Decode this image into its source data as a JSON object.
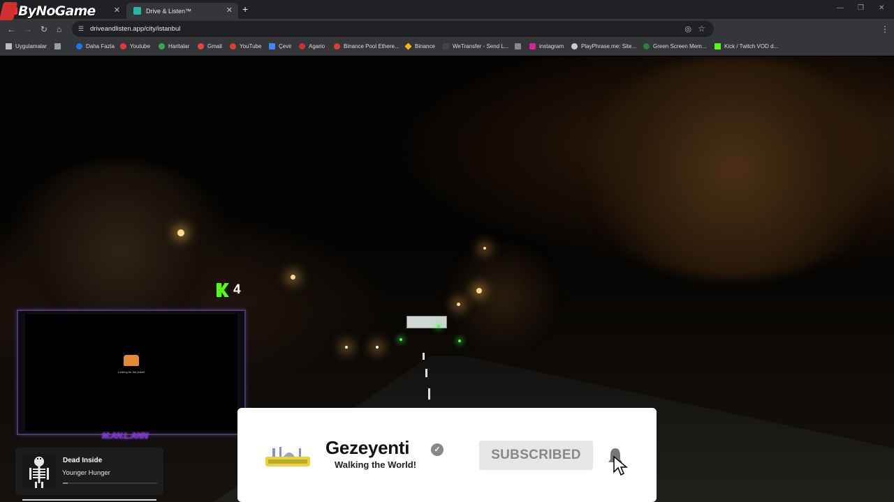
{
  "watermark": {
    "brand": "ByNoGame"
  },
  "browser": {
    "tabs": [
      {
        "label": "",
        "active": false,
        "color": "#e33"
      },
      {
        "label": "Drive & Listen™",
        "active": true,
        "color": "#2bb5a0"
      }
    ],
    "new_tab": "+",
    "url": "driveandlisten.app/city/istanbul",
    "bookmarks": [
      {
        "label": "Uygulamalar",
        "icon": "apps-grid-icon",
        "color": "#bbb"
      },
      {
        "label": "Daha Fazla",
        "icon": "facebook-icon",
        "color": "#1877f2"
      },
      {
        "label": "Youtube",
        "icon": "youtube-icon",
        "color": "#e53935"
      },
      {
        "label": "Haritalar",
        "icon": "maps-icon",
        "color": "#34a853"
      },
      {
        "label": "Gmail",
        "icon": "gmail-icon",
        "color": "#ea4335"
      },
      {
        "label": "YouTube",
        "icon": "youtube-icon",
        "color": "#e53935"
      },
      {
        "label": "Çevir",
        "icon": "translate-icon",
        "color": "#4285f4"
      },
      {
        "label": "Agario",
        "icon": "agario-icon",
        "color": "#d32f2f"
      },
      {
        "label": "Binance Pool Ethere...",
        "icon": "youtube-icon",
        "color": "#e53935"
      },
      {
        "label": "Binance",
        "icon": "binance-icon",
        "color": "#f0b90b"
      },
      {
        "label": "WeTransfer - Send L...",
        "icon": "wetransfer-icon",
        "color": "#444"
      },
      {
        "label": "",
        "icon": "bookmark-icon",
        "color": "#888"
      },
      {
        "label": "instagram",
        "icon": "instagram-icon",
        "color": "#d6249f"
      },
      {
        "label": "PlayPhrase.me: Site...",
        "icon": "playphrase-icon",
        "color": "#ccc"
      },
      {
        "label": "Green Screen Mem...",
        "icon": "greenscreen-icon",
        "color": "#2e7d32"
      },
      {
        "label": "Kick / Twitch VOD d...",
        "icon": "kick-icon",
        "color": "#53fc18"
      }
    ]
  },
  "overlay": {
    "kick_count": "4",
    "cam_caption": "Looking for the planet",
    "cam_name": "M.AN.L.ANN"
  },
  "music": {
    "title": "Dead Inside",
    "artist": "Younger Hunger",
    "progress": 0.05
  },
  "banner": {
    "channel": "Gezeyenti",
    "tagline": "Walking the World!",
    "subscribe_label": "SUBSCRIBED",
    "verified_mark": "✓"
  }
}
